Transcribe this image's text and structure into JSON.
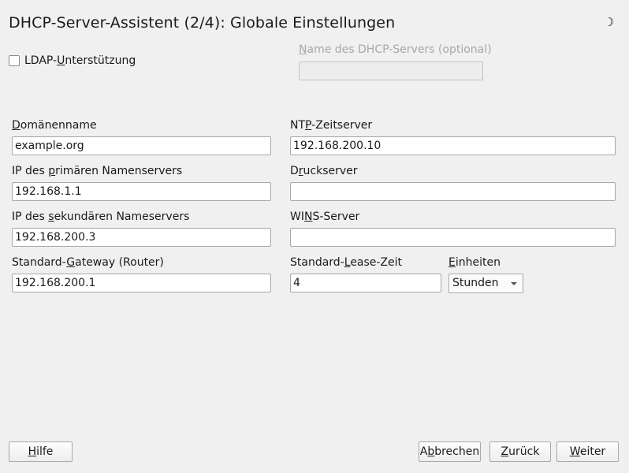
{
  "window": {
    "title": "DHCP-Server-Assistent (2/4): Globale Einstellungen",
    "status_icon": "moon-icon"
  },
  "ldap": {
    "label_pre": "LDAP-",
    "label_key": "U",
    "label_post": "nterstützung",
    "checked": false
  },
  "server_name": {
    "label_key": "N",
    "label_post": "ame des DHCP-Servers (optional)",
    "value": ""
  },
  "domain": {
    "label_key": "D",
    "label_post": "omänenname",
    "value": "example.org"
  },
  "ntp": {
    "label_pre": "NT",
    "label_key": "P",
    "label_post": "-Zeitserver",
    "value": "192.168.200.10"
  },
  "primary_ns": {
    "label_pre": "IP des ",
    "label_key": "p",
    "label_post": "rimären Namenservers",
    "value": "192.168.1.1"
  },
  "print_server": {
    "label_pre": "D",
    "label_key": "r",
    "label_post": "uckserver",
    "value": ""
  },
  "secondary_ns": {
    "label_pre": "IP des ",
    "label_key": "s",
    "label_post": "ekundären Nameservers",
    "value": "192.168.200.3"
  },
  "wins": {
    "label_pre": "WI",
    "label_key": "N",
    "label_post": "S-Server",
    "value": ""
  },
  "gateway": {
    "label_pre": "Standard-",
    "label_key": "G",
    "label_post": "ateway (Router)",
    "value": "192.168.200.1"
  },
  "lease": {
    "label_pre": "Standard-",
    "label_key": "L",
    "label_post": "ease-Zeit",
    "value": "4"
  },
  "units": {
    "label_key": "E",
    "label_post": "inheiten",
    "selected": "Stunden"
  },
  "buttons": {
    "help": {
      "key": "H",
      "post": "ilfe"
    },
    "cancel": {
      "pre": "A",
      "key": "b",
      "post": "brechen"
    },
    "back": {
      "key": "Z",
      "post": "urück"
    },
    "next": {
      "key": "W",
      "post": "eiter"
    }
  }
}
